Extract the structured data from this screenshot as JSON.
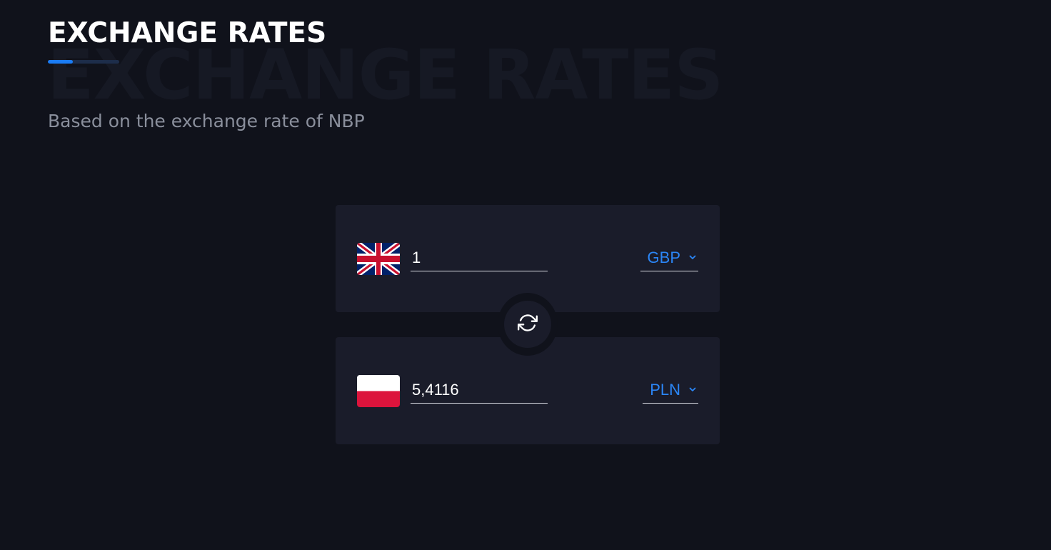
{
  "header": {
    "title": "EXCHANGE RATES",
    "background_title": "EXCHANGE RATES",
    "subtitle": "Based on the exchange rate of NBP",
    "accent_color": "#1a7cf5"
  },
  "converter": {
    "from": {
      "flag_icon": "uk-flag-icon",
      "amount": "1",
      "currency": "GBP"
    },
    "to": {
      "flag_icon": "poland-flag-icon",
      "amount": "5,4116",
      "currency": "PLN"
    },
    "swap_icon": "refresh-icon",
    "currency_color": "#2b86f7"
  }
}
